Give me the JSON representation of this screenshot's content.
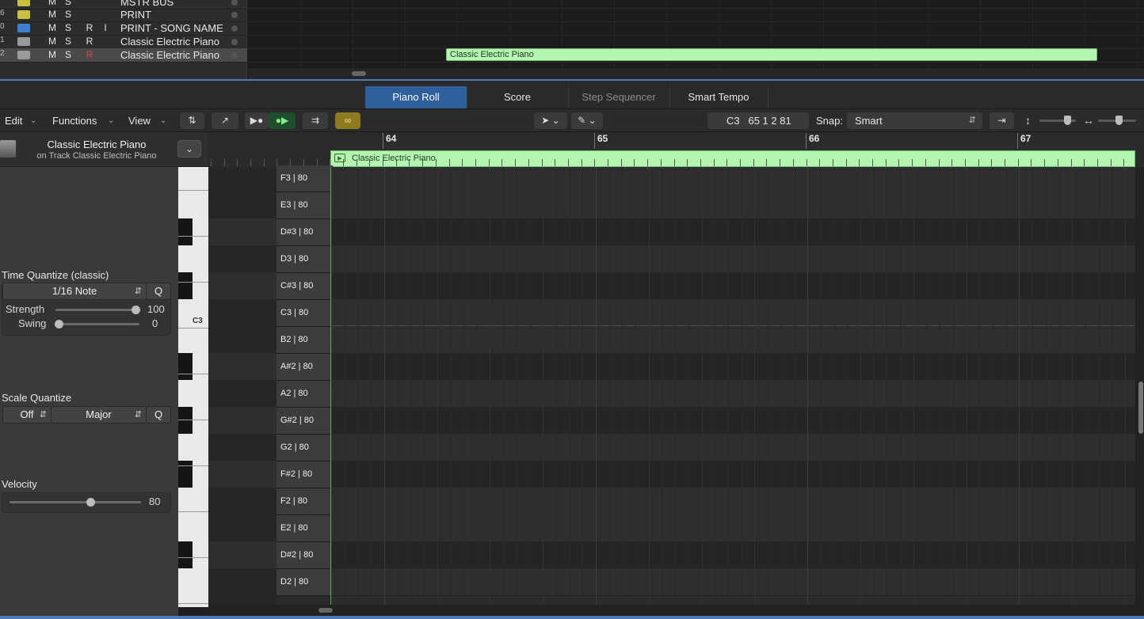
{
  "tracks": [
    {
      "num": "",
      "mute": "M",
      "solo": "S",
      "rec": "",
      "input": "",
      "name": "MSTR BUS",
      "icon_color": "#c8c040",
      "selected": false
    },
    {
      "num": "6",
      "mute": "M",
      "solo": "S",
      "rec": "",
      "input": "",
      "name": "PRINT",
      "icon_color": "#c8c040",
      "selected": false
    },
    {
      "num": "0",
      "mute": "M",
      "solo": "S",
      "rec": "R",
      "input": "I",
      "name": "PRINT - SONG NAME",
      "icon_color": "#3f7fd0",
      "selected": false
    },
    {
      "num": "1",
      "mute": "M",
      "solo": "S",
      "rec": "R",
      "input": "",
      "name": "Classic Electric Piano",
      "icon_color": "#9a9a9a",
      "selected": false
    },
    {
      "num": "2",
      "mute": "M",
      "solo": "S",
      "rec": "R",
      "input": "",
      "name": "Classic Electric Piano",
      "icon_color": "#9a9a9a",
      "selected": true,
      "rec_armed": true
    }
  ],
  "arrange_region": {
    "name": "Classic Electric Piano"
  },
  "tabs": [
    {
      "label": "Piano Roll",
      "active": true
    },
    {
      "label": "Score",
      "active": false
    },
    {
      "label": "Step Sequencer",
      "active": false,
      "dim": true
    },
    {
      "label": "Smart Tempo",
      "active": false
    }
  ],
  "toolbar": {
    "edit": "Edit",
    "functions": "Functions",
    "view": "View",
    "lcd_note": "C3",
    "lcd_position": "65 1 2 81",
    "snap_label": "Snap:",
    "snap_value": "Smart"
  },
  "inspector": {
    "region_name": "Classic Electric Piano",
    "region_track": "on Track Classic Electric Piano",
    "time_quantize_title": "Time Quantize (classic)",
    "time_quantize_value": "1/16 Note",
    "q_button": "Q",
    "strength_label": "Strength",
    "strength_value": "100",
    "swing_label": "Swing",
    "swing_value": "0",
    "scale_quantize_title": "Scale Quantize",
    "scale_root": "Off",
    "scale_type": "Major",
    "velocity_title": "Velocity",
    "velocity_value": "80"
  },
  "keyboard": {
    "c3_label": "C3"
  },
  "note_rows": [
    {
      "label": "F3 | 80",
      "black": false
    },
    {
      "label": "E3 | 80",
      "black": false
    },
    {
      "label": "D#3 | 80",
      "black": true
    },
    {
      "label": "D3 | 80",
      "black": false
    },
    {
      "label": "C#3 | 80",
      "black": true
    },
    {
      "label": "C3 | 80",
      "black": false
    },
    {
      "label": "B2 | 80",
      "black": false
    },
    {
      "label": "A#2 | 80",
      "black": true
    },
    {
      "label": "A2 | 80",
      "black": false
    },
    {
      "label": "G#2 | 80",
      "black": true
    },
    {
      "label": "G2 | 80",
      "black": false
    },
    {
      "label": "F#2 | 80",
      "black": true
    },
    {
      "label": "F2 | 80",
      "black": false
    },
    {
      "label": "E2 | 80",
      "black": false
    },
    {
      "label": "D#2 | 80",
      "black": true
    },
    {
      "label": "D2 | 80",
      "black": false
    }
  ],
  "ruler": {
    "bars": [
      "64",
      "65",
      "66",
      "67"
    ]
  },
  "editor_region": {
    "name": "Classic Electric Piano"
  },
  "colors": {
    "region_green": "#b5f5b2",
    "tab_active_blue": "#2f5f9c",
    "selection_blue": "#4d79b8"
  }
}
